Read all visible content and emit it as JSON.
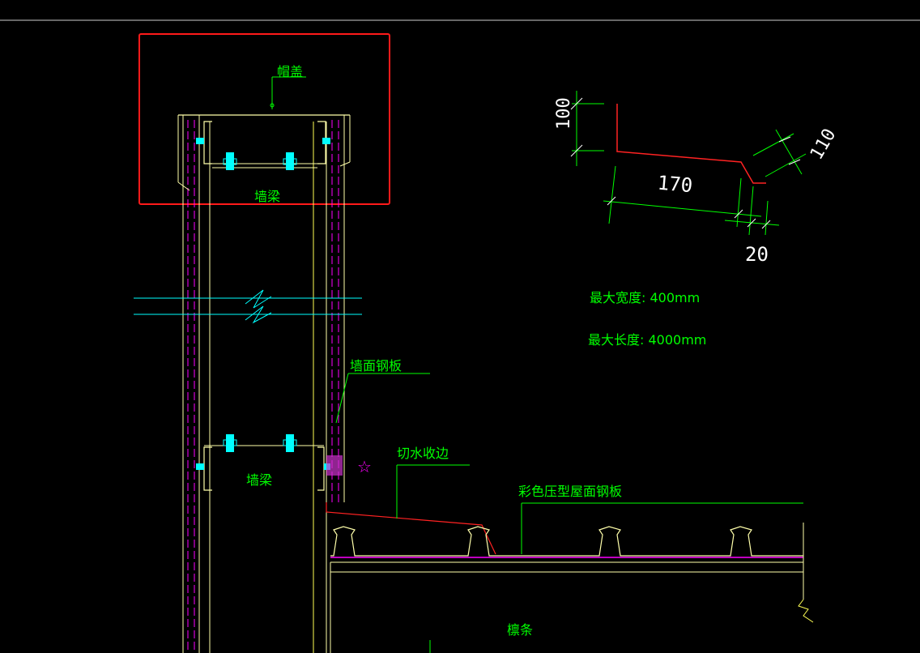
{
  "labels": {
    "cap": "帽盖",
    "wall_beam_top": "墙梁",
    "wall_beam_bottom": "墙梁",
    "wall_panel": "墙面钢板",
    "flashing": "切水收边",
    "roof_panel": "彩色压型屋面钢板",
    "purlin": "檩条",
    "max_width": "最大宽度: 400mm",
    "max_length": "最大长度: 4000mm"
  },
  "dimensions": {
    "d100": "100",
    "d170": "170",
    "d110": "110",
    "d20": "20"
  },
  "symbols": {
    "star": "☆"
  },
  "colors": {
    "background": "#000000",
    "text": "#00ff00",
    "frame": "#ff1a1a",
    "steel": "#ffff99",
    "dashed": "#ff00ff",
    "cyan": "#00ffff",
    "grid": "#ffffff"
  }
}
